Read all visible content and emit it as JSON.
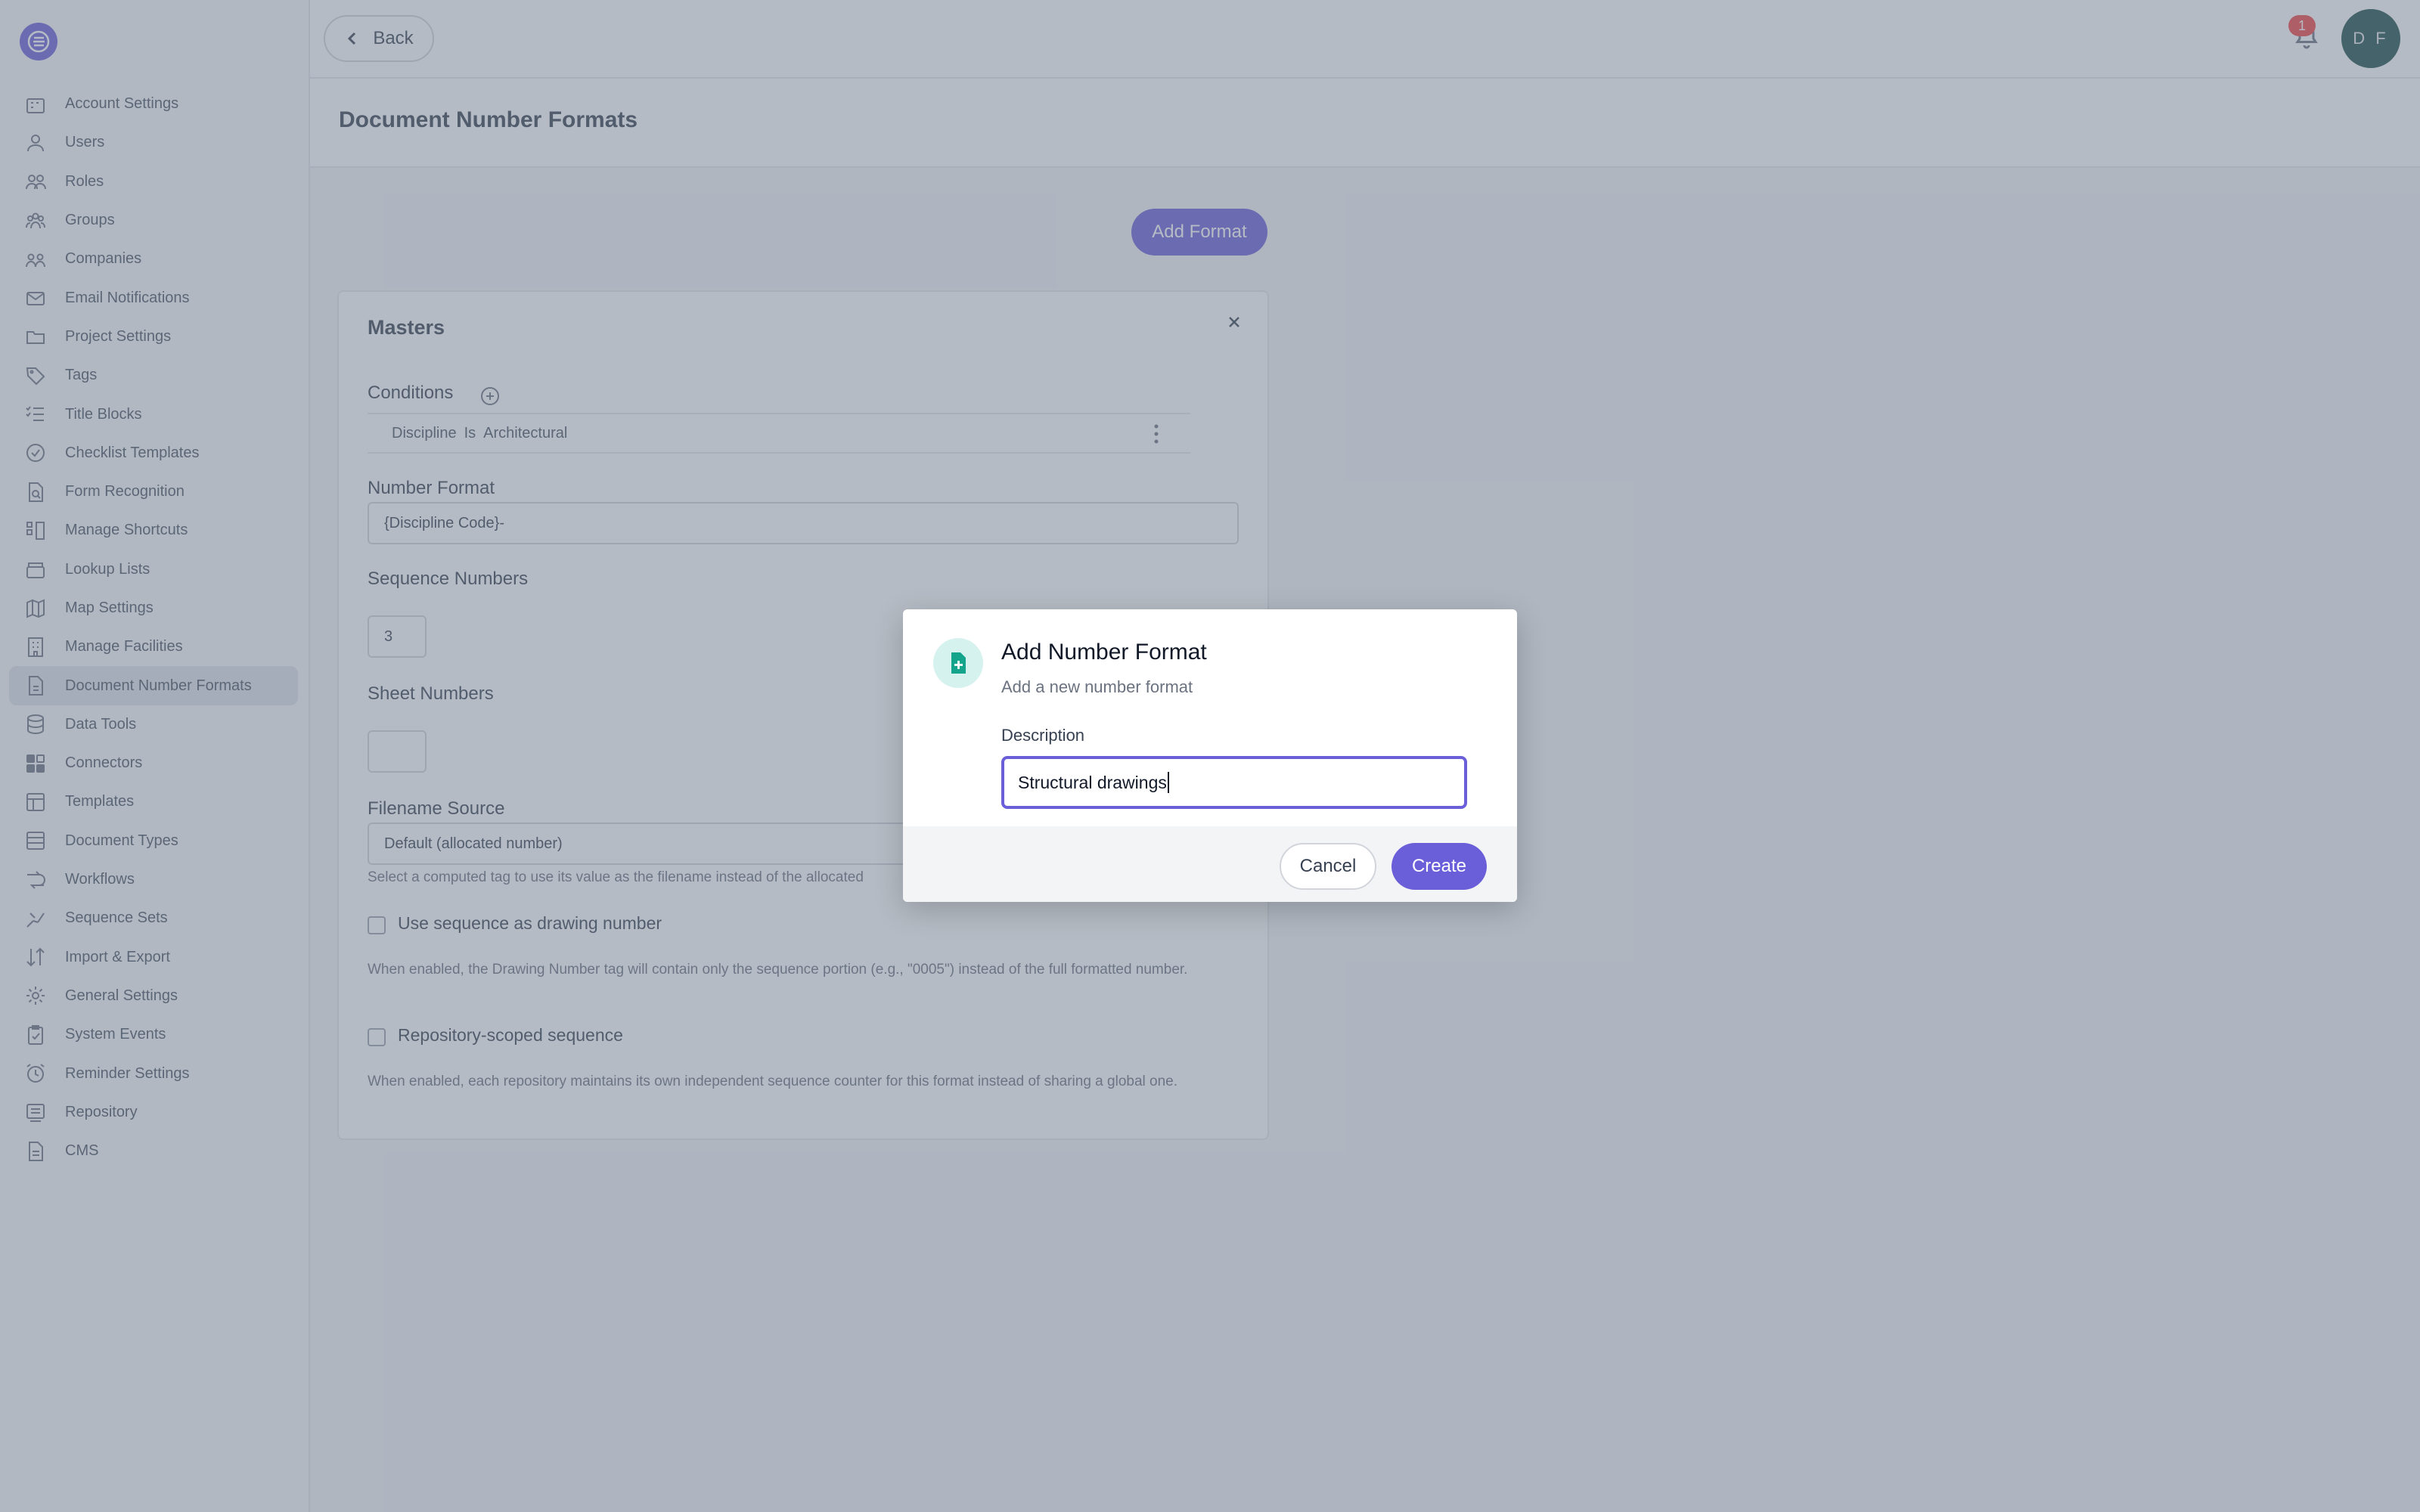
{
  "sidebar": {
    "items": [
      {
        "label": "Account Settings",
        "icon": "building-icon"
      },
      {
        "label": "Users",
        "icon": "user-icon"
      },
      {
        "label": "Roles",
        "icon": "roles-icon"
      },
      {
        "label": "Groups",
        "icon": "group-icon"
      },
      {
        "label": "Companies",
        "icon": "companies-icon"
      },
      {
        "label": "Email Notifications",
        "icon": "mail-icon"
      },
      {
        "label": "Project Settings",
        "icon": "folder-icon"
      },
      {
        "label": "Tags",
        "icon": "tag-icon"
      },
      {
        "label": "Title Blocks",
        "icon": "list-check-icon"
      },
      {
        "label": "Checklist Templates",
        "icon": "check-circle-icon"
      },
      {
        "label": "Form Recognition",
        "icon": "file-search-icon"
      },
      {
        "label": "Manage Shortcuts",
        "icon": "shortcuts-icon"
      },
      {
        "label": "Lookup Lists",
        "icon": "archive-icon"
      },
      {
        "label": "Map Settings",
        "icon": "map-icon"
      },
      {
        "label": "Manage Facilities",
        "icon": "facility-icon"
      },
      {
        "label": "Document Number Formats",
        "icon": "file-number-icon"
      },
      {
        "label": "Data Tools",
        "icon": "database-icon"
      },
      {
        "label": "Connectors",
        "icon": "grid-icon"
      },
      {
        "label": "Templates",
        "icon": "template-icon"
      },
      {
        "label": "Document Types",
        "icon": "layout-icon"
      },
      {
        "label": "Workflows",
        "icon": "workflow-icon"
      },
      {
        "label": "Sequence Sets",
        "icon": "sequence-icon"
      },
      {
        "label": "Import & Export",
        "icon": "import-export-icon"
      },
      {
        "label": "General Settings",
        "icon": "gear-icon"
      },
      {
        "label": "System Events",
        "icon": "clipboard-check-icon"
      },
      {
        "label": "Reminder Settings",
        "icon": "alarm-icon"
      },
      {
        "label": "Repository",
        "icon": "repository-icon"
      },
      {
        "label": "CMS",
        "icon": "file-icon"
      }
    ],
    "active_index": 15
  },
  "topbar": {
    "back_label": "Back",
    "notification_count": "1",
    "avatar_initials": "D F"
  },
  "page": {
    "title": "Document Number Formats",
    "add_format_label": "Add Format"
  },
  "card": {
    "title": "Masters",
    "conditions_label": "Conditions",
    "condition": {
      "field": "Discipline",
      "operator": "Is",
      "value": "Architectural"
    },
    "number_format_label": "Number Format",
    "number_format_value": "{Discipline Code}-",
    "sequence_numbers_label": "Sequence Numbers",
    "sequence_numbers_value": "3",
    "sheet_numbers_label": "Sheet Numbers",
    "sheet_numbers_value": "",
    "filename_source_label": "Filename Source",
    "filename_source_value": "Default (allocated number)",
    "filename_source_help": "Select a computed tag to use its value as the filename instead of the allocated",
    "use_sequence_label": "Use sequence as drawing number",
    "use_sequence_help": "When enabled, the Drawing Number tag will contain only the sequence portion (e.g., \"0005\") instead of the full formatted number.",
    "repo_scoped_label": "Repository-scoped sequence",
    "repo_scoped_help": "When enabled, each repository maintains its own independent sequence counter for this format instead of sharing a global one."
  },
  "modal": {
    "title": "Add Number Format",
    "subtitle": "Add a new number format",
    "description_label": "Description",
    "description_value": "Structural drawings",
    "cancel_label": "Cancel",
    "create_label": "Create"
  },
  "colors": {
    "accent": "#6b5fd9",
    "avatar_bg": "#1f4f4a",
    "badge": "#ef4444",
    "modal_icon_bg": "#d5f2ee",
    "modal_icon_fg": "#14a38b"
  }
}
